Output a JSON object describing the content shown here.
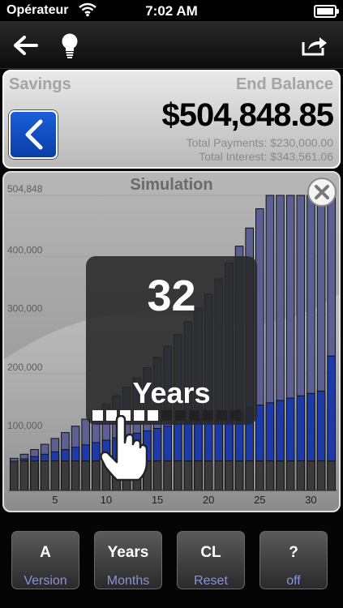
{
  "status": {
    "carrier": "Opérateur",
    "time": "7:02 AM"
  },
  "toolbar": {
    "back": "back-arrow-icon",
    "tip": "lightbulb-icon",
    "share": "share-icon"
  },
  "savings": {
    "title": "Savings",
    "end_label": "End Balance",
    "amount": "$504,848.85",
    "total_payments": "Total Payments: $230,000.00",
    "total_interest": "Total Interest: $343,561.06"
  },
  "simulation": {
    "title": "Simulation",
    "overlay_number": "32",
    "overlay_unit": "Years"
  },
  "chart_data": {
    "type": "bar",
    "ylim": [
      0,
      504848
    ],
    "ytick_labels": [
      "504,848",
      "400,000",
      "300,000",
      "200,000",
      "100,000"
    ],
    "yticks": [
      504848,
      400000,
      300000,
      200000,
      100000
    ],
    "xtick_labels": [
      "5",
      "10",
      "15",
      "20",
      "25",
      "30"
    ],
    "xticks": [
      5,
      10,
      15,
      20,
      25,
      30
    ],
    "x": [
      1,
      2,
      3,
      4,
      5,
      6,
      7,
      8,
      9,
      10,
      11,
      12,
      13,
      14,
      15,
      16,
      17,
      18,
      19,
      20,
      21,
      22,
      23,
      24,
      25,
      26,
      27,
      28,
      29,
      30,
      31,
      32
    ],
    "series": [
      {
        "values": [
          55000,
          62000,
          70000,
          79000,
          89000,
          99000,
          110000,
          122000,
          135000,
          148000,
          162000,
          177000,
          193000,
          210000,
          228000,
          247000,
          267000,
          289000,
          312000,
          336000,
          362000,
          389000,
          418000,
          449000,
          482000,
          517000,
          554000,
          594000,
          636000,
          681000,
          728000,
          504848
        ]
      },
      {
        "values": [
          50000,
          54000,
          58000,
          62000,
          66000,
          70000,
          74000,
          78000,
          82000,
          86000,
          90000,
          94000,
          98000,
          102000,
          106000,
          110000,
          114000,
          118000,
          122000,
          126000,
          130000,
          134000,
          138000,
          142000,
          146000,
          150000,
          154000,
          158000,
          162000,
          166000,
          170000,
          230000
        ]
      }
    ],
    "grid": true
  },
  "bottom": [
    {
      "top": "A",
      "bottom": "Version"
    },
    {
      "top": "Years",
      "bottom": "Months"
    },
    {
      "top": "CL",
      "bottom": "Reset"
    },
    {
      "top": "?",
      "bottom": "off"
    }
  ],
  "colors": {
    "accent": "#0a3ea8",
    "principal": "#1c3aa8",
    "total": "#5b5f92",
    "base": "#3a3a3a"
  }
}
